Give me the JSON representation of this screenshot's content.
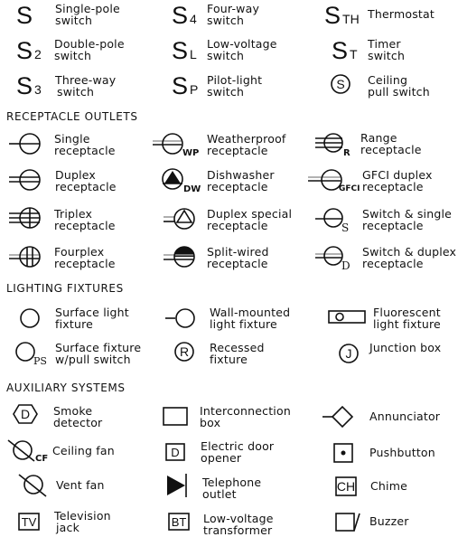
{
  "switches": {
    "items": [
      {
        "symbol": "S",
        "sub": "",
        "label1": "Single-pole",
        "label2": "switch"
      },
      {
        "symbol": "S",
        "sub": "2",
        "label1": "Double-pole",
        "label2": "switch"
      },
      {
        "symbol": "S",
        "sub": "3",
        "label1": "Three-way",
        "label2": "switch"
      },
      {
        "symbol": "S",
        "sub": "4",
        "label1": "Four-way",
        "label2": "switch"
      },
      {
        "symbol": "S",
        "sub": "L",
        "label1": "Low-voltage",
        "label2": "switch"
      },
      {
        "symbol": "S",
        "sub": "P",
        "label1": "Pilot-light",
        "label2": "switch"
      },
      {
        "symbol": "S",
        "sub": "TH",
        "label1": "Thermostat",
        "label2": ""
      },
      {
        "symbol": "S",
        "sub": "T",
        "label1": "Timer",
        "label2": "switch"
      },
      {
        "symbol": "S",
        "sub": "",
        "label1": "Ceiling",
        "label2": "pull switch",
        "circled_letter": "S"
      }
    ]
  },
  "receptacles": {
    "heading": "RECEPTACLE OUTLETS",
    "items": [
      {
        "label1": "Single",
        "label2": "receptacle"
      },
      {
        "label1": "Duplex",
        "label2": "receptacle"
      },
      {
        "label1": "Triplex",
        "label2": "receptacle"
      },
      {
        "label1": "Fourplex",
        "label2": "receptacle"
      },
      {
        "label1": "Weatherproof",
        "label2": "receptacle",
        "sub": "WP"
      },
      {
        "label1": "Dishwasher",
        "label2": "receptacle",
        "sub": "DW"
      },
      {
        "label1": "Duplex special",
        "label2": "receptacle"
      },
      {
        "label1": "Split-wired",
        "label2": "receptacle"
      },
      {
        "label1": "Range",
        "label2": "receptacle",
        "sub": "R"
      },
      {
        "label1": "GFCI duplex",
        "label2": "receptacle",
        "sub": "GFCI"
      },
      {
        "label1": "Switch & single",
        "label2": "receptacle",
        "sub": "S"
      },
      {
        "label1": "Switch & duplex",
        "label2": "receptacle",
        "sub": "D"
      }
    ]
  },
  "lighting": {
    "heading": "LIGHTING FIXTURES",
    "items": [
      {
        "label1": "Surface light",
        "label2": "fixture"
      },
      {
        "label1": "Surface fixture",
        "label2": "w/pull switch",
        "sub": "PS"
      },
      {
        "label1": "Wall-mounted",
        "label2": "light fixture"
      },
      {
        "label1": "Recessed",
        "label2": "fixture",
        "circled_letter": "R"
      },
      {
        "label1": "Fluorescent",
        "label2": "light fixture"
      },
      {
        "label1": "Junction box",
        "label2": "",
        "circled_letter": "J"
      }
    ]
  },
  "auxiliary": {
    "heading": "AUXILIARY SYSTEMS",
    "items": [
      {
        "label1": "Smoke",
        "label2": "detector",
        "box_letter": "D"
      },
      {
        "label1": "Ceiling fan",
        "label2": "",
        "sub": "CF"
      },
      {
        "label1": "Vent fan",
        "label2": ""
      },
      {
        "label1": "Television",
        "label2": "jack",
        "box_letter": "TV"
      },
      {
        "label1": "Interconnection",
        "label2": "box"
      },
      {
        "label1": "Electric door",
        "label2": "opener",
        "box_letter": "D"
      },
      {
        "label1": "Telephone",
        "label2": "outlet"
      },
      {
        "label1": "Low-voltage",
        "label2": "transformer",
        "box_letter": "BT"
      },
      {
        "label1": "Annunciator",
        "label2": ""
      },
      {
        "label1": "Pushbutton",
        "label2": ""
      },
      {
        "label1": "Chime",
        "label2": "",
        "box_letter": "CH"
      },
      {
        "label1": "Buzzer",
        "label2": ""
      }
    ]
  }
}
